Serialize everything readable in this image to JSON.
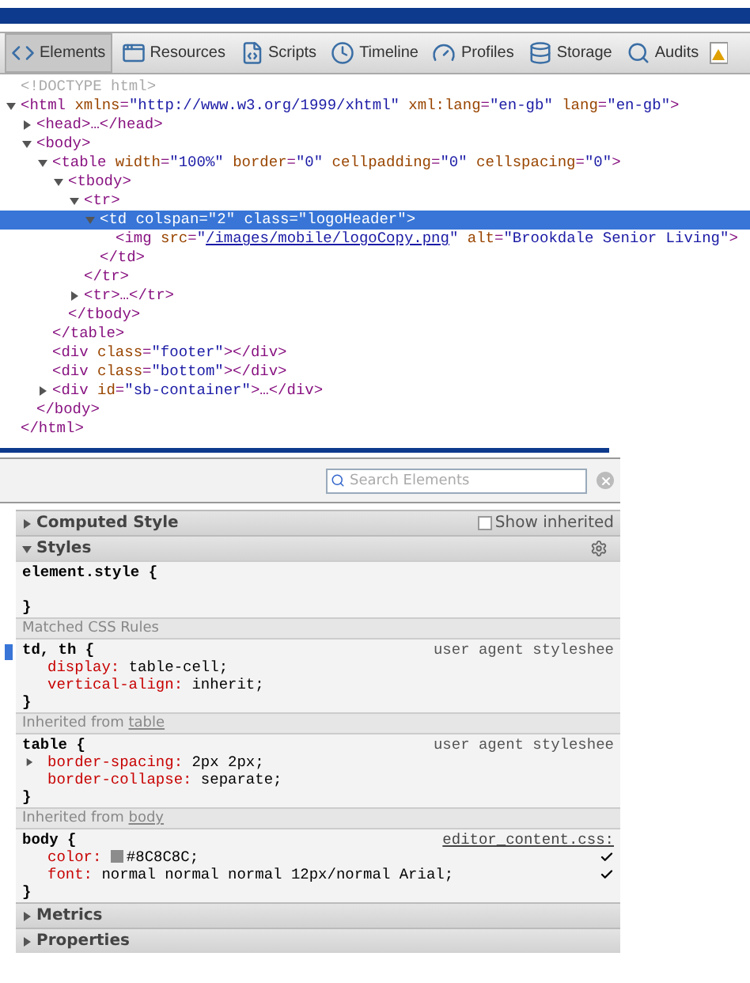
{
  "toolbar": {
    "tabs": [
      {
        "label": "Elements",
        "selected": true
      },
      {
        "label": "Resources",
        "selected": false
      },
      {
        "label": "Scripts",
        "selected": false
      },
      {
        "label": "Timeline",
        "selected": false
      },
      {
        "label": "Profiles",
        "selected": false
      },
      {
        "label": "Storage",
        "selected": false
      },
      {
        "label": "Audits",
        "selected": false
      }
    ]
  },
  "dom_tree": [
    {
      "kind": "doctype",
      "text": "<!DOCTYPE html>",
      "selected": false
    },
    {
      "kind": "element",
      "text": "<html xmlns=\"http://www.w3.org/1999/xhtml\" xml:lang=\"en-gb\" lang=\"en-gb\">",
      "expanded": true,
      "selected": false,
      "close": "</html>",
      "children": [
        {
          "kind": "element",
          "text": "<head>…</head>",
          "expanded": false,
          "selected": false
        },
        {
          "kind": "element",
          "text": "<body>",
          "expanded": true,
          "selected": false,
          "close": "</body>",
          "children": [
            {
              "kind": "element",
              "text": "<table width=\"100%\" border=\"0\" cellpadding=\"0\" cellspacing=\"0\">",
              "expanded": true,
              "selected": false,
              "close": "</table>",
              "children": [
                {
                  "kind": "element",
                  "text": "<tbody>",
                  "expanded": true,
                  "selected": false,
                  "close": "</tbody>",
                  "children": [
                    {
                      "kind": "element",
                      "text": "<tr>",
                      "expanded": true,
                      "selected": false,
                      "close": "</tr>",
                      "children": [
                        {
                          "kind": "element",
                          "text": "<td colspan=\"2\" class=\"logoHeader\">",
                          "expanded": true,
                          "selected": true,
                          "close": "</td>",
                          "children": [
                            {
                              "kind": "leaf",
                              "text": "<img src=\"/images/mobile/logoCopy.png\" alt=\"Brookdale Senior Living\">",
                              "link": true,
                              "selected": false
                            }
                          ]
                        }
                      ]
                    },
                    {
                      "kind": "element",
                      "text": "<tr>…</tr>",
                      "expanded": false,
                      "selected": false
                    }
                  ]
                }
              ]
            },
            {
              "kind": "leaf",
              "text": "<div class=\"footer\"></div>",
              "selected": false
            },
            {
              "kind": "leaf",
              "text": "<div class=\"bottom\"></div>",
              "selected": false
            },
            {
              "kind": "element",
              "text": "<div id=\"sb-container\">…</div>",
              "expanded": false,
              "selected": false
            }
          ]
        }
      ]
    }
  ],
  "search": {
    "placeholder": "Search Elements"
  },
  "sections": [
    {
      "kind": "header",
      "label": "Computed Style",
      "expanded": false,
      "option": {
        "label": "Show inherited",
        "checked": false
      }
    },
    {
      "kind": "header",
      "label": "Styles",
      "expanded": true,
      "gear": true
    },
    {
      "kind": "rule",
      "selector": "element.style {",
      "close": "}"
    },
    {
      "kind": "group",
      "label": "Matched CSS Rules"
    },
    {
      "kind": "rule",
      "selector": "td, th {",
      "source": "user agent styleshee",
      "source_link": false,
      "properties": [
        {
          "name": "display:",
          "value": "table-cell;"
        },
        {
          "name": "vertical-align:",
          "value": "inherit;"
        }
      ],
      "close": "}"
    },
    {
      "kind": "group",
      "label": "Inherited from ",
      "link": "table"
    },
    {
      "kind": "rule",
      "selector": "table {",
      "source": "user agent styleshee",
      "source_link": false,
      "properties": [
        {
          "name": "border-spacing:",
          "value": "2px 2px;",
          "expandable": true
        },
        {
          "name": "border-collapse:",
          "value": "separate;"
        }
      ],
      "close": "}"
    },
    {
      "kind": "group",
      "label": "Inherited from ",
      "link": "body"
    },
    {
      "kind": "rule",
      "selector": "body {",
      "source": "editor_content.css:",
      "source_link": true,
      "properties": [
        {
          "name": "color:",
          "value": "#8C8C8C;",
          "kind": "color",
          "checked": true
        },
        {
          "name": "font:",
          "value": "normal normal normal 12px/normal Arial;",
          "checked": true
        }
      ],
      "close": "}"
    },
    {
      "kind": "header",
      "label": "Metrics",
      "expanded": false
    },
    {
      "kind": "header",
      "label": "Properties",
      "expanded": false
    }
  ]
}
